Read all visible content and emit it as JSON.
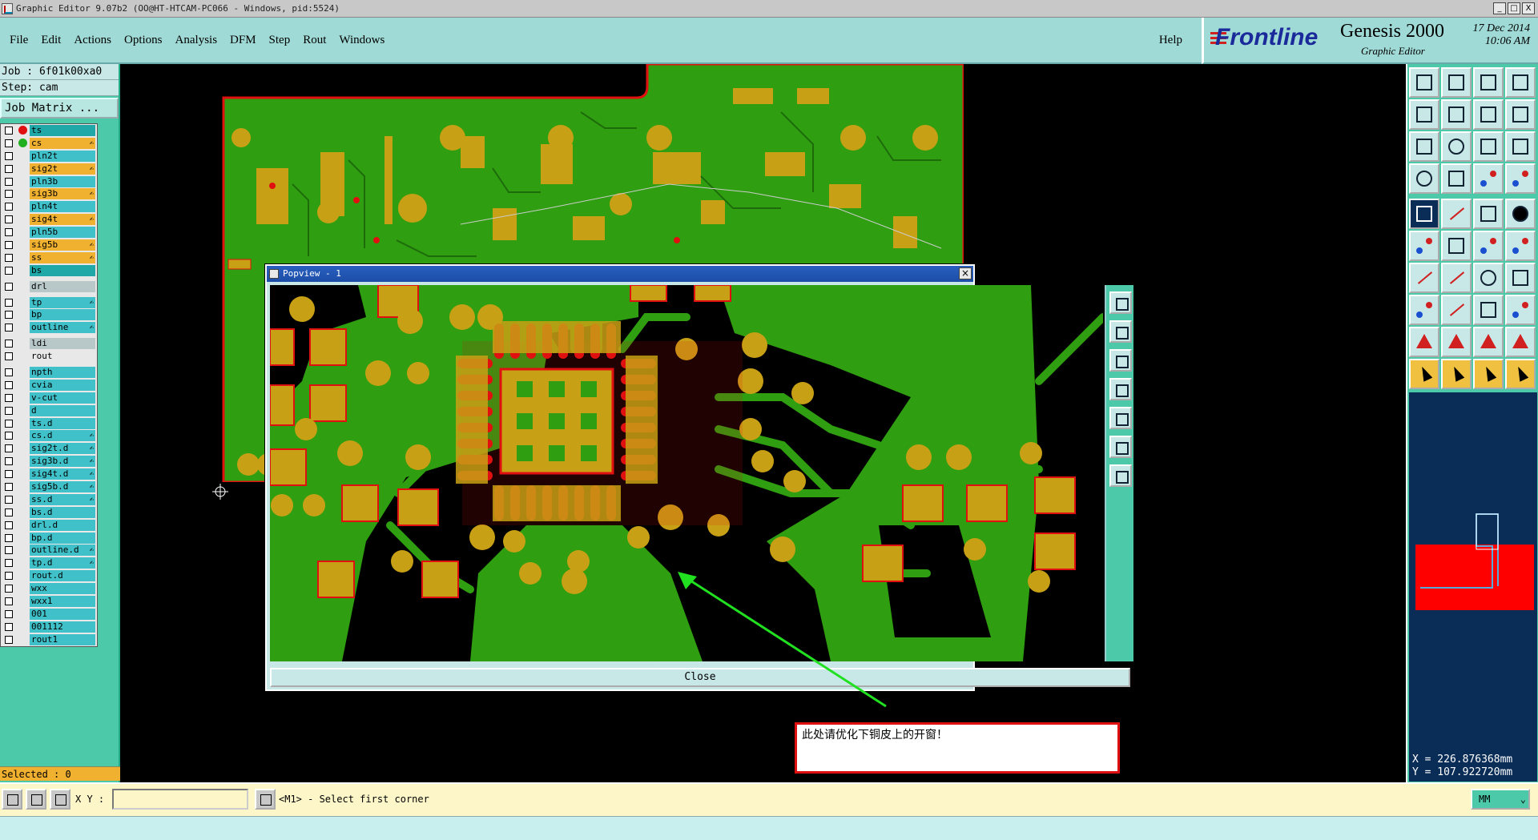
{
  "window": {
    "title": "Graphic Editor 9.07b2 (OO@HT-HTCAM-PC066 - Windows, pid:5524)",
    "controls": [
      "_",
      "□",
      "X"
    ]
  },
  "menu": {
    "items": [
      "File",
      "Edit",
      "Actions",
      "Options",
      "Analysis",
      "DFM",
      "Step",
      "Rout",
      "Windows"
    ],
    "help": "Help"
  },
  "brand": {
    "logo": "Frontline",
    "product": "Genesis 2000",
    "subtitle": "Graphic Editor",
    "date": "17 Dec 2014",
    "time": "10:06 AM"
  },
  "job": {
    "job_line": "Job : 6f01k00xa0",
    "step_line": "Step: cam",
    "matrix_button": "Job Matrix ..."
  },
  "layers": [
    {
      "name": "ts",
      "color": "teal",
      "dot": "#e01010",
      "edit": "",
      "gap": false
    },
    {
      "name": "cs",
      "color": "orange",
      "dot": "#20b020",
      "edit": "✍",
      "gap": false
    },
    {
      "name": "pln2t",
      "color": "",
      "dot": "",
      "edit": "",
      "gap": false
    },
    {
      "name": "sig2t",
      "color": "orange",
      "dot": "",
      "edit": "✍",
      "gap": false
    },
    {
      "name": "pln3b",
      "color": "",
      "dot": "",
      "edit": "",
      "gap": false
    },
    {
      "name": "sig3b",
      "color": "orange",
      "dot": "",
      "edit": "✍",
      "gap": false
    },
    {
      "name": "pln4t",
      "color": "",
      "dot": "",
      "edit": "",
      "gap": false
    },
    {
      "name": "sig4t",
      "color": "orange",
      "dot": "",
      "edit": "✍",
      "gap": false
    },
    {
      "name": "pln5b",
      "color": "",
      "dot": "",
      "edit": "",
      "gap": false
    },
    {
      "name": "sig5b",
      "color": "orange",
      "dot": "",
      "edit": "✍",
      "gap": false
    },
    {
      "name": "ss",
      "color": "orange",
      "dot": "",
      "edit": "✍",
      "gap": false
    },
    {
      "name": "bs",
      "color": "teal",
      "dot": "",
      "edit": "",
      "gap": false
    },
    {
      "name": "drl",
      "color": "gray",
      "dot": "",
      "edit": "",
      "gap": true
    },
    {
      "name": "tp",
      "color": "",
      "dot": "",
      "edit": "✍",
      "gap": true
    },
    {
      "name": "bp",
      "color": "",
      "dot": "",
      "edit": "",
      "gap": false
    },
    {
      "name": "outline",
      "color": "",
      "dot": "",
      "edit": "✍",
      "gap": false
    },
    {
      "name": "ldi",
      "color": "gray",
      "dot": "",
      "edit": "",
      "gap": true
    },
    {
      "name": "rout",
      "color": "light",
      "dot": "",
      "edit": "",
      "gap": false
    },
    {
      "name": "npth",
      "color": "",
      "dot": "",
      "edit": "",
      "gap": true
    },
    {
      "name": "cvia",
      "color": "",
      "dot": "",
      "edit": "",
      "gap": false
    },
    {
      "name": "v-cut",
      "color": "",
      "dot": "",
      "edit": "",
      "gap": false
    },
    {
      "name": "d",
      "color": "",
      "dot": "",
      "edit": "",
      "gap": false
    },
    {
      "name": "ts.d",
      "color": "",
      "dot": "",
      "edit": "",
      "gap": false
    },
    {
      "name": "cs.d",
      "color": "",
      "dot": "",
      "edit": "✍",
      "gap": false
    },
    {
      "name": "sig2t.d",
      "color": "",
      "dot": "",
      "edit": "✍",
      "gap": false
    },
    {
      "name": "sig3b.d",
      "color": "",
      "dot": "",
      "edit": "✍",
      "gap": false
    },
    {
      "name": "sig4t.d",
      "color": "",
      "dot": "",
      "edit": "✍",
      "gap": false
    },
    {
      "name": "sig5b.d",
      "color": "",
      "dot": "",
      "edit": "✍",
      "gap": false
    },
    {
      "name": "ss.d",
      "color": "",
      "dot": "",
      "edit": "✍",
      "gap": false
    },
    {
      "name": "bs.d",
      "color": "",
      "dot": "",
      "edit": "",
      "gap": false
    },
    {
      "name": "drl.d",
      "color": "",
      "dot": "",
      "edit": "",
      "gap": false
    },
    {
      "name": "bp.d",
      "color": "",
      "dot": "",
      "edit": "",
      "gap": false
    },
    {
      "name": "outline.d",
      "color": "",
      "dot": "",
      "edit": "✍",
      "gap": false
    },
    {
      "name": "tp.d",
      "color": "",
      "dot": "",
      "edit": "✍",
      "gap": false
    },
    {
      "name": "rout.d",
      "color": "",
      "dot": "",
      "edit": "",
      "gap": false
    },
    {
      "name": "wxx",
      "color": "",
      "dot": "",
      "edit": "",
      "gap": false
    },
    {
      "name": "wxx1",
      "color": "",
      "dot": "",
      "edit": "",
      "gap": false
    },
    {
      "name": "001",
      "color": "",
      "dot": "",
      "edit": "",
      "gap": false
    },
    {
      "name": "001112",
      "color": "",
      "dot": "",
      "edit": "",
      "gap": false
    },
    {
      "name": "rout1",
      "color": "",
      "dot": "",
      "edit": "",
      "gap": false
    }
  ],
  "selected": "Selected : 0",
  "popview": {
    "title": "Popview - 1",
    "close_label": "Close"
  },
  "annotation": {
    "text": "此处请优化下铜皮上的开窗！",
    "color": "#e01010",
    "arrow_color": "#20e020"
  },
  "board_colors": {
    "copper": "#c8a015",
    "ground": "#2f9e11",
    "outline": "#e01010"
  },
  "coords": {
    "x": "X = 226.876368mm",
    "y": "Y = 107.922720mm"
  },
  "bottom": {
    "xy_label": "X Y :",
    "xy_value": "",
    "prompt": "<M1> - Select first corner",
    "units": "MM"
  }
}
